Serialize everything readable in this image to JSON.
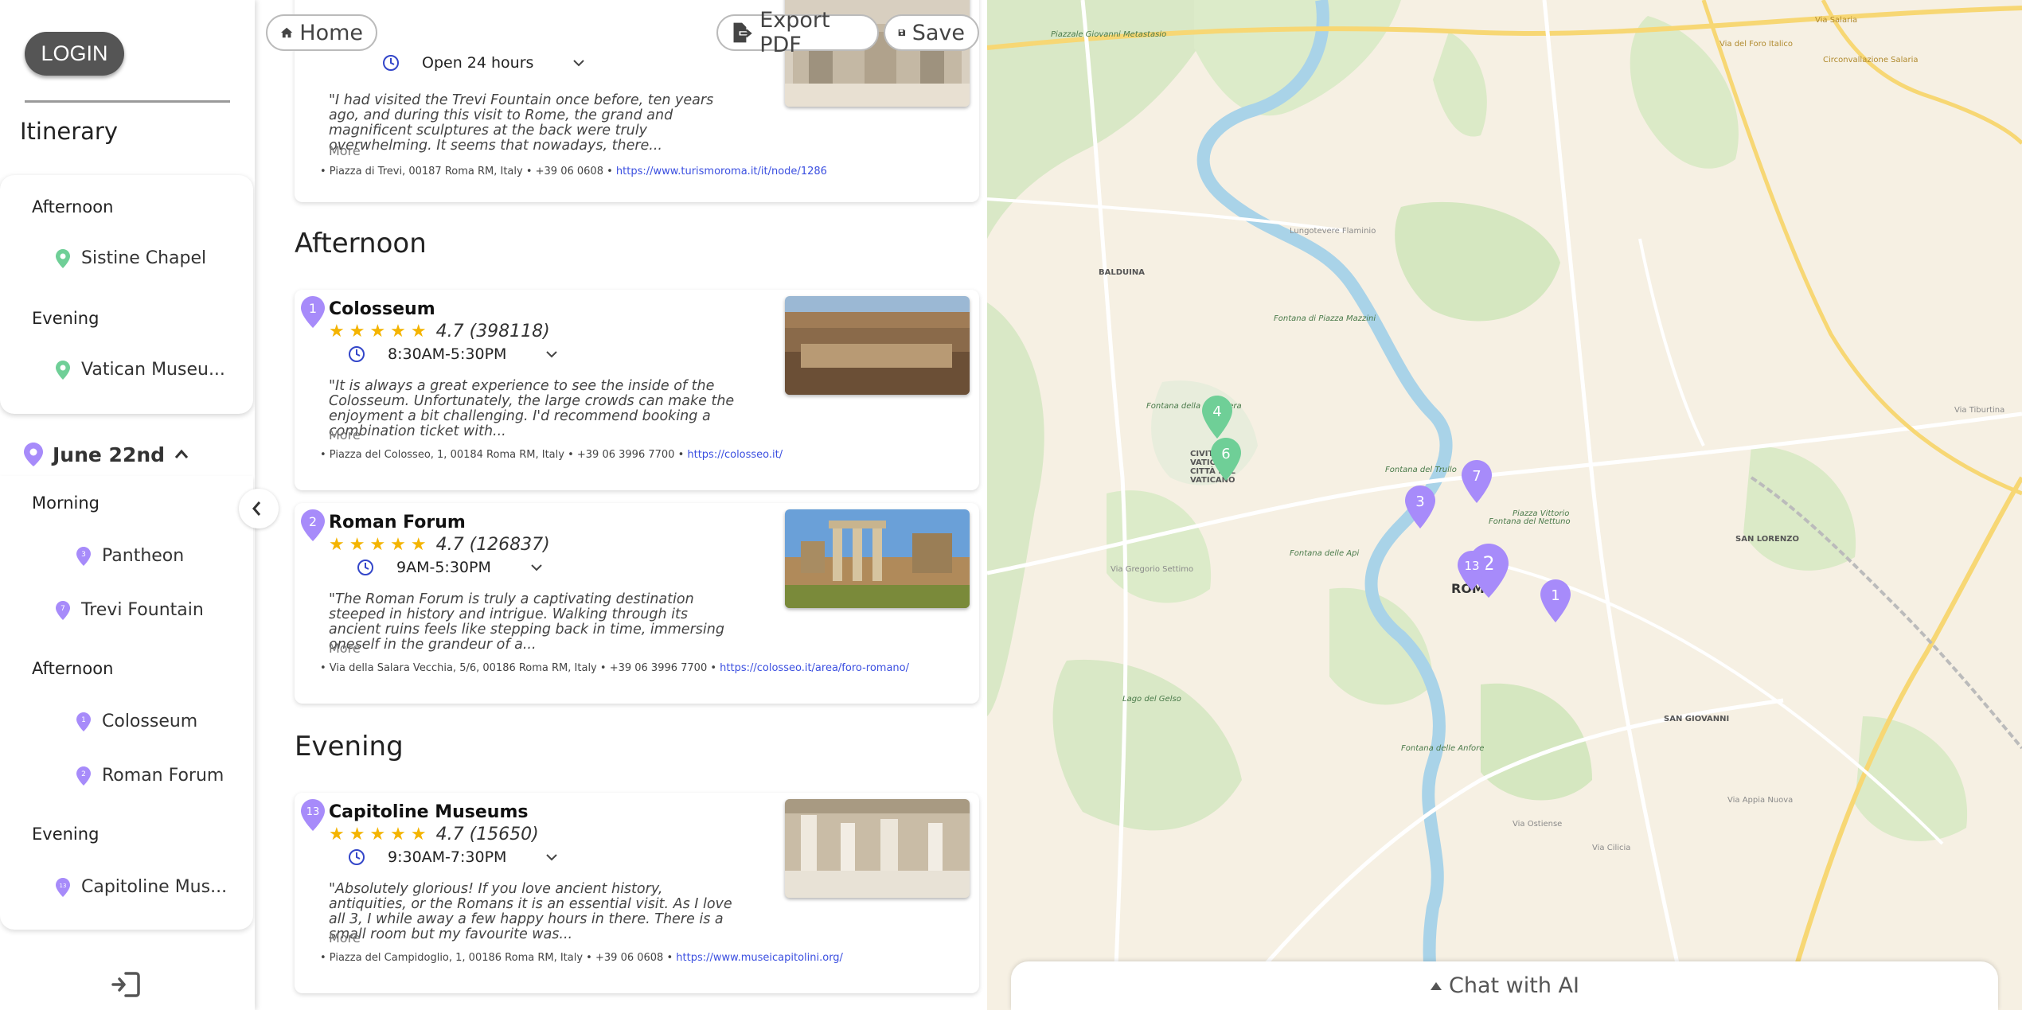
{
  "sidebar": {
    "login_label": "LOGIN",
    "title": "Itinerary",
    "day1": {
      "periods": [
        {
          "label": "Afternoon",
          "stops": [
            {
              "label": "Sistine Chapel",
              "pin_number": "6"
            }
          ]
        },
        {
          "label": "Evening",
          "stops": [
            {
              "label": "Vatican Museu...",
              "pin_number": "4"
            }
          ]
        }
      ]
    },
    "day2": {
      "date": "June 22nd",
      "periods": [
        {
          "label": "Morning",
          "stops": [
            {
              "label": "Pantheon",
              "pin_number": "3"
            },
            {
              "label": "Trevi Fountain",
              "pin_number": "7"
            }
          ]
        },
        {
          "label": "Afternoon",
          "stops": [
            {
              "label": "Colosseum",
              "pin_number": "1"
            },
            {
              "label": "Roman Forum",
              "pin_number": "2"
            }
          ]
        },
        {
          "label": "Evening",
          "stops": [
            {
              "label": "Capitoline Mus...",
              "pin_number": "13"
            }
          ]
        }
      ]
    }
  },
  "toolbar": {
    "home_label": "Home",
    "export_label": "Export PDF",
    "save_label": "Save"
  },
  "main": {
    "trevi_partial": {
      "hours": "Open 24 hours",
      "review": "\"I had visited the Trevi Fountain once before, ten years ago, and during this visit to Rome, the grand and magnificent sculptures at the back were truly overwhelming. It seems that nowadays, there...",
      "more": "More",
      "address": "• Piazza di Trevi, 00187 Roma RM, Italy •",
      "phone": "+39 06 0608 •",
      "url": "https://www.turismoroma.it/it/node/1286"
    },
    "afternoon_title": "Afternoon",
    "evening_title": "Evening",
    "places": [
      {
        "num": "1",
        "name": "Colosseum",
        "stars": "★★★★★",
        "rating": "4.7 (398118)",
        "hours": "8:30AM-5:30PM",
        "review": "\"It is always a great experience to see the inside of the Colosseum. Unfortunately, the large crowds can make the enjoyment a bit challenging. I'd recommend booking a combination ticket with...",
        "more": "More",
        "address": "• Piazza del Colosseo, 1, 00184 Roma RM, Italy •",
        "phone": "+39 06 3996 7700 •",
        "url": "https://colosseo.it/"
      },
      {
        "num": "2",
        "name": "Roman Forum",
        "stars": "★★★★★",
        "rating": "4.7 (126837)",
        "hours": "9AM-5:30PM",
        "review": "\"The Roman Forum is truly a captivating destination steeped in history and intrigue. Walking through its ancient ruins feels like stepping back in time, immersing oneself in the grandeur of a...",
        "more": "More",
        "address": "• Via della Salara Vecchia, 5/6, 00186 Roma RM, Italy •",
        "phone": "+39 06 3996 7700 •",
        "url": "https://colosseo.it/area/foro-romano/"
      },
      {
        "num": "13",
        "name": "Capitoline Museums",
        "stars": "★★★★★",
        "rating": "4.7 (15650)",
        "hours": "9:30AM-7:30PM",
        "review": "\"Absolutely glorious! If you love ancient history, antiquities, or the Romans it is an essential visit. As I love all 3, I while away a few happy hours in there. There is a small room but my favourite was...",
        "more": "More",
        "address": "• Piazza del Campidoglio, 1, 00186 Roma RM, Italy •",
        "phone": "+39 06 0608 •",
        "url": "https://www.museicapitolini.org/"
      }
    ]
  },
  "map": {
    "city_label": "ROM.",
    "markers": [
      "1",
      "2",
      "3",
      "7",
      "13",
      "4",
      "6"
    ],
    "labels": [
      "Piazzale Giovanni Metastasio",
      "Via del Foro Italico",
      "Circonvallazione Salaria",
      "Via Salaria",
      "BALDUINA",
      "Fontana della Peschiera",
      "CIVITÀ VATICANA CITTÀ DEL VATICANO",
      "Lungotevere Flaminio",
      "Fontana di Piazza Mazzini",
      "Fontana del Trullo",
      "Via Tiburtina",
      "SAN LORENZO",
      "SAN GIOVANNI",
      "Via Gregorio Settimo",
      "Lago del Gelso",
      "Fontana del Nettuno",
      "Via Ostiense",
      "Via Cilicia",
      "Fontana delle Anfore",
      "Fontana delle Api",
      "Via Appia Nuova",
      "Piazza Vittorio"
    ],
    "chat_label": "Chat with AI"
  }
}
